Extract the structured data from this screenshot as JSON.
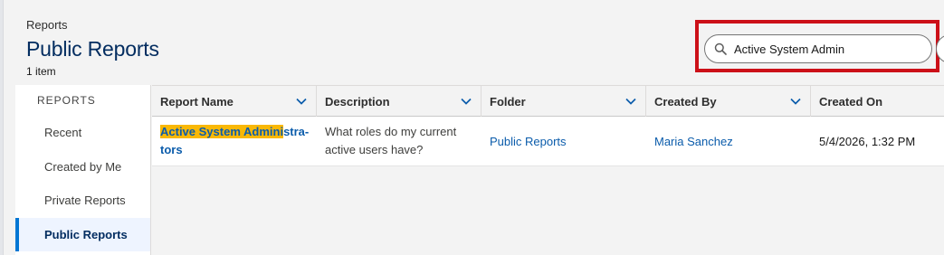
{
  "header": {
    "breadcrumb": "Reports",
    "title": "Public Reports",
    "item_count": "1 item"
  },
  "search": {
    "value": "Active System Admin",
    "icon": "search-icon"
  },
  "sidebar": {
    "heading": "REPORTS",
    "items": [
      {
        "label": "Recent"
      },
      {
        "label": "Created by Me"
      },
      {
        "label": "Private Reports"
      },
      {
        "label": "Public Reports",
        "active": true
      }
    ]
  },
  "table": {
    "columns": [
      {
        "label": "Report Name"
      },
      {
        "label": "Description"
      },
      {
        "label": "Folder"
      },
      {
        "label": "Created By"
      },
      {
        "label": "Created On"
      }
    ],
    "rows": [
      {
        "report_name_highlight": "Active System Admini",
        "report_name_rest_1": "stra-",
        "report_name_rest_2": "tors",
        "description_line1": "What roles do my current",
        "description_line2": "active users have?",
        "folder": "Public Reports",
        "created_by": "Maria Sanchez",
        "created_on": "5/4/2026, 1:32 PM"
      }
    ]
  },
  "colors": {
    "highlight_box": "#cc1018",
    "title": "#032d60",
    "link": "#0b5cab",
    "match_highlight": "#f9b806",
    "active_accent": "#0176d3"
  }
}
